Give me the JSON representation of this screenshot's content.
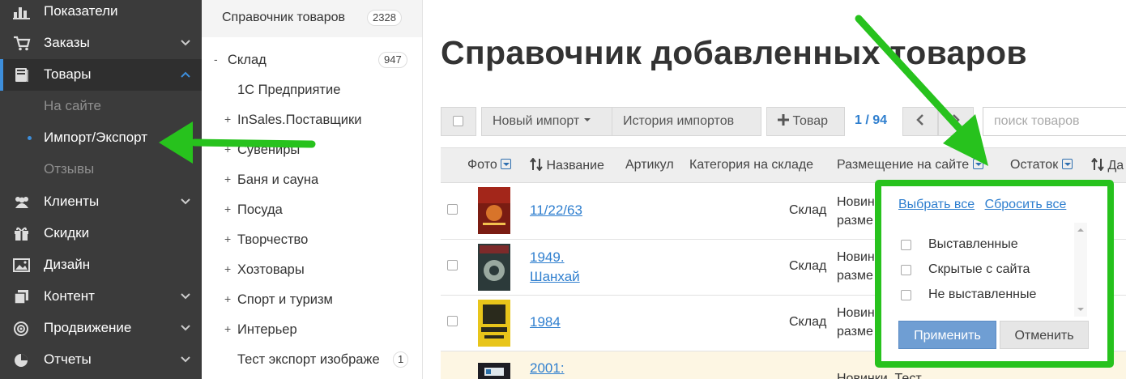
{
  "sidebar": {
    "items": [
      {
        "label": "Показатели",
        "icon": "bar-chart-icon",
        "chevron": false
      },
      {
        "label": "Заказы",
        "icon": "cart-icon",
        "chevron": true
      },
      {
        "label": "Товары",
        "icon": "book-icon",
        "chevron": true
      },
      {
        "label": "Клиенты",
        "icon": "users-icon",
        "chevron": true
      },
      {
        "label": "Скидки",
        "icon": "gift-icon",
        "chevron": false
      },
      {
        "label": "Дизайн",
        "icon": "image-icon",
        "chevron": false
      },
      {
        "label": "Контент",
        "icon": "documents-icon",
        "chevron": true
      },
      {
        "label": "Продвижение",
        "icon": "target-icon",
        "chevron": true
      },
      {
        "label": "Отчеты",
        "icon": "pie-chart-icon",
        "chevron": true
      }
    ],
    "sub_items": [
      "На сайте",
      "Импорт/Экспорт",
      "Отзывы"
    ]
  },
  "categories": {
    "header": "Справочник товаров",
    "header_count": "2328",
    "items": [
      {
        "sign": "-",
        "label": "Склад",
        "count": "947"
      },
      {
        "sign": "",
        "label": "1С Предприятие",
        "count": ""
      },
      {
        "sign": "+",
        "label": "InSales.Поставщики",
        "count": ""
      },
      {
        "sign": "+",
        "label": "Сувениры",
        "count": ""
      },
      {
        "sign": "+",
        "label": "Баня и сауна",
        "count": ""
      },
      {
        "sign": "+",
        "label": "Посуда",
        "count": ""
      },
      {
        "sign": "+",
        "label": "Творчество",
        "count": ""
      },
      {
        "sign": "+",
        "label": "Хозтовары",
        "count": ""
      },
      {
        "sign": "+",
        "label": "Спорт и туризм",
        "count": ""
      },
      {
        "sign": "+",
        "label": "Интерьер",
        "count": ""
      },
      {
        "sign": "",
        "label": "Тест экспорт изображе",
        "count": "1"
      }
    ]
  },
  "main": {
    "title": "Справочник добавленных товаров",
    "toolbar": {
      "new_import": "Новый импорт",
      "history": "История импортов",
      "add_product": "Товар",
      "pager": "1 / 94",
      "search_placeholder": "поиск товаров"
    },
    "columns": {
      "photo": "Фото",
      "name": "Название",
      "sku": "Артикул",
      "category": "Категория на складе",
      "placement": "Размещение на сайте",
      "stock": "Остаток",
      "date": "Да"
    },
    "rows": [
      {
        "name_1": "11/22/63",
        "name_2": "",
        "category": "Склад",
        "placement_1": "Новин",
        "placement_2": "разме"
      },
      {
        "name_1": "1949.",
        "name_2": "Шанхай",
        "category": "Склад",
        "placement_1": "Новин",
        "placement_2": "разме"
      },
      {
        "name_1": "1984",
        "name_2": "",
        "category": "Склад",
        "placement_1": "Новин",
        "placement_2": "разме"
      },
      {
        "name_1": "2001:",
        "name_2": "",
        "category": "",
        "placement_1": "Новинки, Тест",
        "placement_2": ""
      }
    ]
  },
  "filter_popup": {
    "select_all": "Выбрать все",
    "reset_all": "Сбросить все",
    "options": [
      "Выставленные",
      "Скрытые с сайта",
      "Не выставленные"
    ],
    "apply": "Применить",
    "cancel": "Отменить"
  },
  "colors": {
    "sidebar_bg": "#3b3b3b",
    "accent_blue": "#3d8edb",
    "link_blue": "#2f7fcf",
    "highlight_green": "#27c21d",
    "apply_button": "#6f9ed3"
  }
}
